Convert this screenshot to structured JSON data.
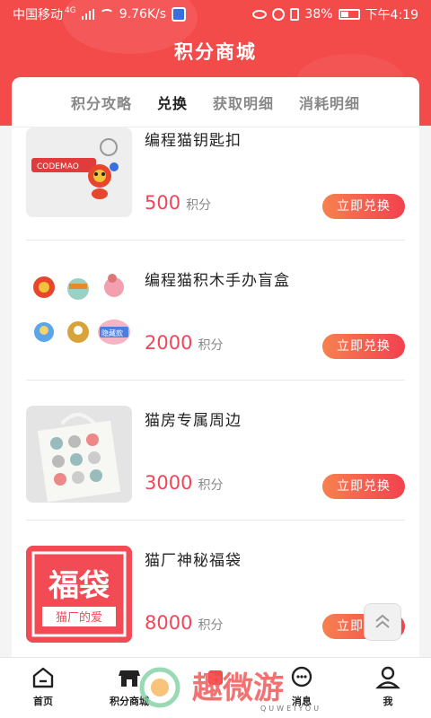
{
  "status_bar": {
    "carrier": "中国移动",
    "network": "4G",
    "speed": "9.76K/s",
    "battery": "38%",
    "time": "下午4:19"
  },
  "header": {
    "title": "积分商城"
  },
  "tabs": [
    {
      "label": "积分攻略",
      "active": false
    },
    {
      "label": "兑换",
      "active": true
    },
    {
      "label": "获取明细",
      "active": false
    },
    {
      "label": "消耗明细",
      "active": false
    }
  ],
  "items": [
    {
      "name": "编程猫钥匙扣",
      "price": "500",
      "unit": "积分",
      "button": "立即兑换",
      "thumb_text": "CODEMAO"
    },
    {
      "name": "编程猫积木手办盲盒",
      "price": "2000",
      "unit": "积分",
      "button": "立即兑换",
      "thumb_text": "隐藏款"
    },
    {
      "name": "猫房专属周边",
      "price": "3000",
      "unit": "积分",
      "button": "立即兑换"
    },
    {
      "name": "猫厂神秘福袋",
      "price": "8000",
      "unit": "积分",
      "button": "立即兑换",
      "thumb_text": "福袋",
      "thumb_subtext": "猫厂的爱"
    }
  ],
  "nav": [
    {
      "label": "首页",
      "icon": "home-icon"
    },
    {
      "label": "积分商城",
      "icon": "shop-icon"
    },
    {
      "label": "",
      "icon": "center-icon"
    },
    {
      "label": "消息",
      "icon": "message-icon"
    },
    {
      "label": "我",
      "icon": "user-icon"
    }
  ],
  "watermark": {
    "text": "趣微游",
    "subtext": "QUWEIYOU"
  },
  "colors": {
    "primary_red": "#f34a4a",
    "price_red": "#f0465a",
    "button_start": "#f7814f",
    "button_end": "#f2414f"
  }
}
